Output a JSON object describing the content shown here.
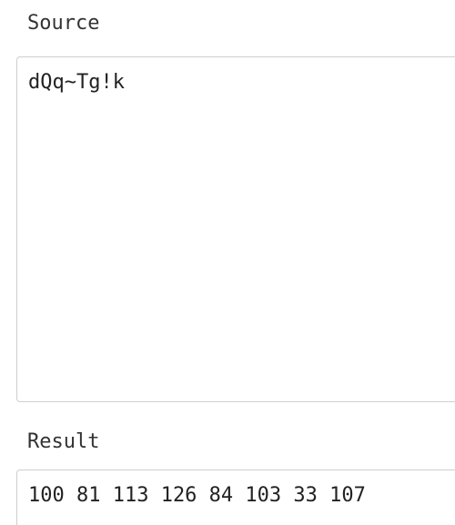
{
  "source": {
    "label": "Source",
    "value": "dQq~Tg!k"
  },
  "result": {
    "label": "Result",
    "value": "100 81 113 126 84 103 33 107"
  }
}
